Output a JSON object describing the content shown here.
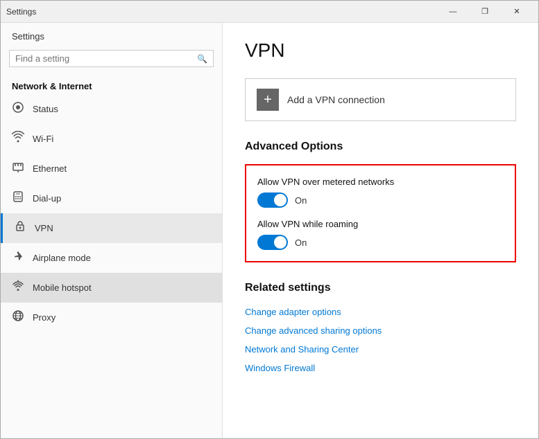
{
  "window": {
    "title": "Settings",
    "controls": {
      "minimize": "—",
      "maximize": "❐",
      "close": "✕"
    }
  },
  "sidebar": {
    "header": "Settings",
    "search": {
      "placeholder": "Find a setting",
      "icon": "🔍"
    },
    "section_label": "Network & Internet",
    "items": [
      {
        "id": "status",
        "label": "Status",
        "icon": "⊙"
      },
      {
        "id": "wifi",
        "label": "Wi-Fi",
        "icon": "〰"
      },
      {
        "id": "ethernet",
        "label": "Ethernet",
        "icon": "🖧"
      },
      {
        "id": "dialup",
        "label": "Dial-up",
        "icon": "📞"
      },
      {
        "id": "vpn",
        "label": "VPN",
        "icon": "🔒",
        "active": true
      },
      {
        "id": "airplane",
        "label": "Airplane mode",
        "icon": "✈"
      },
      {
        "id": "hotspot",
        "label": "Mobile hotspot",
        "icon": "📶",
        "highlighted": true
      },
      {
        "id": "proxy",
        "label": "Proxy",
        "icon": "🌐"
      }
    ]
  },
  "main": {
    "page_title": "VPN",
    "add_vpn": {
      "icon": "+",
      "label": "Add a VPN connection"
    },
    "advanced_options": {
      "section_title": "Advanced Options",
      "option1": {
        "label": "Allow VPN over metered networks",
        "toggle_state": "On"
      },
      "option2": {
        "label": "Allow VPN while roaming",
        "toggle_state": "On"
      }
    },
    "related_settings": {
      "section_title": "Related settings",
      "links": [
        {
          "id": "adapter",
          "label": "Change adapter options"
        },
        {
          "id": "sharing",
          "label": "Change advanced sharing options"
        },
        {
          "id": "network_center",
          "label": "Network and Sharing Center"
        },
        {
          "id": "firewall",
          "label": "Windows Firewall"
        }
      ]
    }
  }
}
